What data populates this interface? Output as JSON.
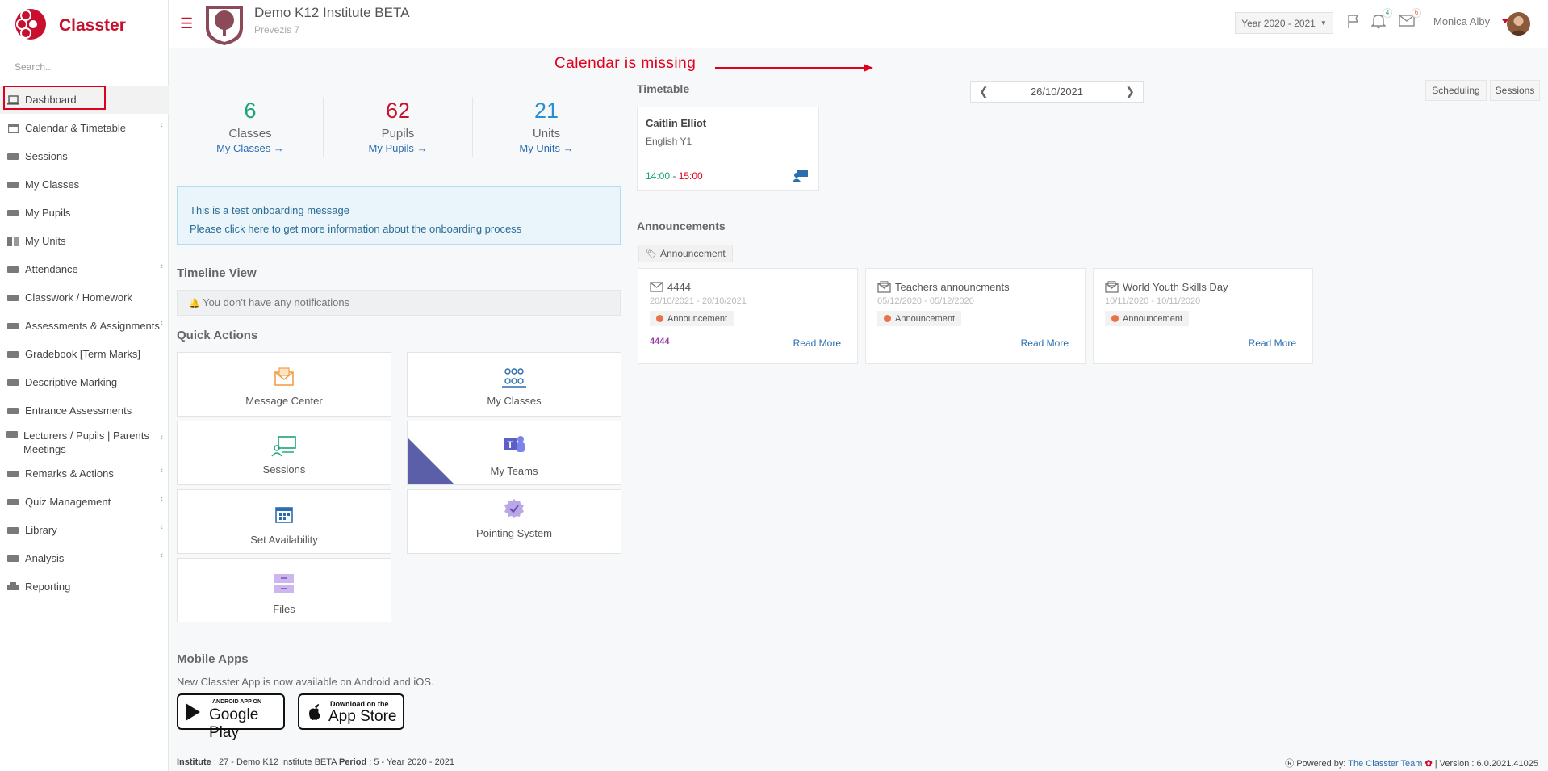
{
  "app": {
    "brand_name": "Classter"
  },
  "sidebar": {
    "search_placeholder": "Search...",
    "items": [
      {
        "label": "Dashboard",
        "icon": "laptop-icon",
        "active": true
      },
      {
        "label": "Calendar & Timetable",
        "icon": "calendar-icon",
        "chevron": true
      },
      {
        "label": "Sessions",
        "icon": "sessions-icon"
      },
      {
        "label": "My Classes",
        "icon": "classes-icon"
      },
      {
        "label": "My Pupils",
        "icon": "pupils-icon"
      },
      {
        "label": "My Units",
        "icon": "book-icon"
      },
      {
        "label": "Attendance",
        "icon": "attendance-icon",
        "chevron": true
      },
      {
        "label": "Classwork / Homework",
        "icon": "list-icon"
      },
      {
        "label": "Assessments & Assignments",
        "icon": "edit-icon",
        "chevron": true
      },
      {
        "label": "Gradebook [Term Marks]",
        "icon": "gradebook-icon"
      },
      {
        "label": "Descriptive Marking",
        "icon": "marking-icon"
      },
      {
        "label": "Entrance Assessments",
        "icon": "entrance-icon"
      },
      {
        "label": "Lecturers / Pupils | Parents Meetings",
        "icon": "meetings-icon",
        "chevron": true
      },
      {
        "label": "Remarks & Actions",
        "icon": "remarks-icon",
        "chevron": true
      },
      {
        "label": "Quiz Management",
        "icon": "quiz-icon",
        "chevron": true
      },
      {
        "label": "Library",
        "icon": "library-icon",
        "chevron": true
      },
      {
        "label": "Analysis",
        "icon": "analysis-icon",
        "chevron": true
      },
      {
        "label": "Reporting",
        "icon": "printer-icon"
      }
    ]
  },
  "header": {
    "institute_name": "Demo K12 Institute BETA",
    "institute_sub": "Prevezis 7",
    "year": "Year 2020 - 2021",
    "notifications_count": "4",
    "messages_count": "6",
    "user_name": "Monica Alby"
  },
  "annotation": {
    "text": "Calendar is missing"
  },
  "stats": [
    {
      "value": "6",
      "label": "Classes",
      "link": "My Classes",
      "color": "#1aa37a"
    },
    {
      "value": "62",
      "label": "Pupils",
      "link": "My Pupils",
      "color": "#c8102e"
    },
    {
      "value": "21",
      "label": "Units",
      "link": "My Units",
      "color": "#2a8fd0"
    }
  ],
  "onboarding": {
    "line1": "This is a test onboarding message",
    "line2": "Please click here to get more information about the onboarding process"
  },
  "timeline": {
    "title": "Timeline View",
    "empty_text": "You don't have any notifications"
  },
  "quick_actions": {
    "title": "Quick Actions",
    "items": [
      {
        "label": "Message Center",
        "icon": "message-center-icon"
      },
      {
        "label": "My Classes",
        "icon": "classes-group-icon"
      },
      {
        "label": "Sessions",
        "icon": "sessions-board-icon"
      },
      {
        "label": "My Teams",
        "icon": "teams-icon"
      },
      {
        "label": "Set Availability",
        "icon": "availability-calendar-icon"
      },
      {
        "label": "Pointing System",
        "icon": "badge-check-icon"
      },
      {
        "label": "Files",
        "icon": "files-icon"
      }
    ]
  },
  "mobile": {
    "title": "Mobile Apps",
    "text": "New Classter App is now available on Android and iOS.",
    "google_small": "ANDROID APP ON",
    "google_big": "Google Play",
    "apple_small": "Download on the",
    "apple_big": "App Store"
  },
  "timetable": {
    "title": "Timetable",
    "date": "26/10/2021",
    "tabs": [
      "Scheduling",
      "Sessions"
    ],
    "session": {
      "teacher": "Caitlin Elliot",
      "course": "English Y1",
      "start": "14:00",
      "end": "15:00"
    }
  },
  "announcements": {
    "title": "Announcements",
    "filter": "Announcement",
    "items": [
      {
        "title": "4444",
        "dates": "20/10/2021 - 20/10/2021",
        "tag": "Announcement",
        "body": "4444",
        "more": "Read More"
      },
      {
        "title": "Teachers announcments",
        "dates": "05/12/2020 - 05/12/2020",
        "tag": "Announcement",
        "body": "",
        "more": "Read More"
      },
      {
        "title": "World Youth Skills Day",
        "dates": "10/11/2020 - 10/11/2020",
        "tag": "Announcement",
        "body": "",
        "more": "Read More"
      }
    ]
  },
  "footer": {
    "institute_label": "Institute",
    "institute_value": " : 27 - Demo K12 Institute BETA ",
    "period_label": "Period",
    "period_value": " : 5 - Year 2020 - 2021",
    "powered_by": "Powered by:",
    "team": "The Classter Team",
    "version": "| Version : 6.0.2021.41025"
  },
  "colors": {
    "brand": "#c8102e",
    "link": "#2a6db0",
    "annotation": "#e0001b"
  }
}
